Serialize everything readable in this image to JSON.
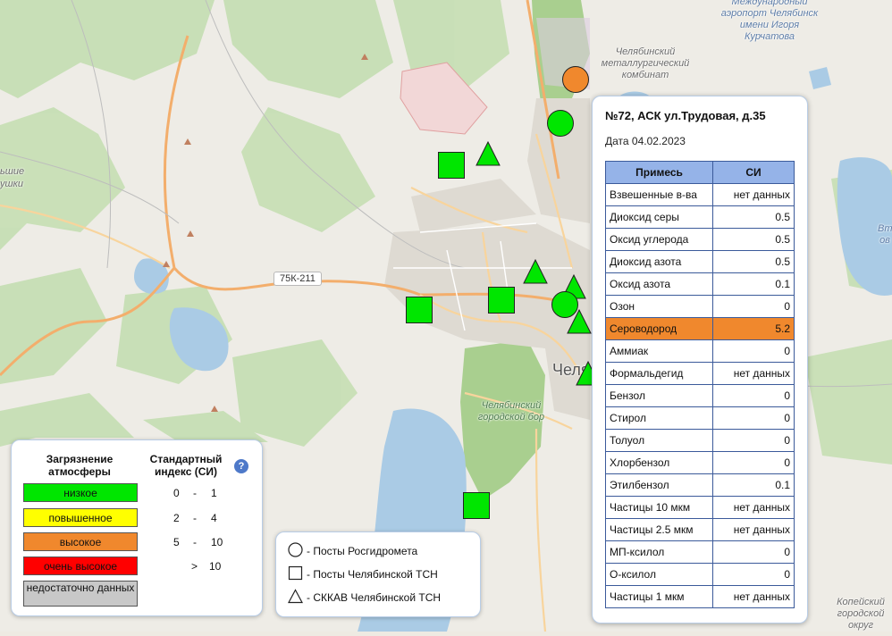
{
  "map": {
    "labels": {
      "airport": "Международный аэропорт Челябинск имени Игоря Курчатова",
      "metallurgical": "Челябинский металлургический комбинат",
      "forest": "Челябинский городской бор",
      "city": "Челя",
      "kopeysk": "Копейский городской округ",
      "edge_left_top": "ьшие",
      "edge_left_bottom": "ушки",
      "edge_right": "Вт ов"
    },
    "road_shield": "75К-211"
  },
  "markers": [
    {
      "shape": "circle",
      "color": "#f0882d",
      "level": "высокое"
    },
    {
      "shape": "circle",
      "color": "#00e600",
      "level": "низкое"
    },
    {
      "shape": "square",
      "color": "#00e600",
      "level": "низкое"
    },
    {
      "shape": "triangle",
      "color": "#00e600",
      "level": "низкое"
    },
    {
      "shape": "triangle",
      "color": "#00e600",
      "level": "низкое"
    },
    {
      "shape": "triangle",
      "color": "#00e600",
      "level": "низкое"
    },
    {
      "shape": "circle",
      "color": "#00e600",
      "level": "низкое"
    },
    {
      "shape": "triangle",
      "color": "#00e600",
      "level": "низкое"
    },
    {
      "shape": "square",
      "color": "#00e600",
      "level": "низкое"
    },
    {
      "shape": "square",
      "color": "#00e600",
      "level": "низкое"
    },
    {
      "shape": "triangle",
      "color": "#00e600",
      "level": "низкое"
    },
    {
      "shape": "square",
      "color": "#00e600",
      "level": "низкое"
    }
  ],
  "legend": {
    "header_pollution": "Загрязнение атмосферы",
    "header_index": "Стандартный индекс (СИ)",
    "help_icon": "?",
    "rows": [
      {
        "label": "низкое",
        "color": "#00e600",
        "from": "0",
        "dash": "-",
        "to": "1"
      },
      {
        "label": "повышенное",
        "color": "#ffff00",
        "from": "2",
        "dash": "-",
        "to": "4"
      },
      {
        "label": "высокое",
        "color": "#f0882d",
        "from": "5",
        "dash": "-",
        "to": "10"
      },
      {
        "label": "очень высокое",
        "color": "#ff0000",
        "from": "",
        "dash": ">",
        "to": "10"
      },
      {
        "label": "недостаточно данных",
        "color": "#c8c8c8",
        "from": "",
        "dash": "",
        "to": ""
      }
    ]
  },
  "symbols": {
    "circle_label": "- Посты Росгидромета",
    "square_label": "- Посты Челябинской ТСН",
    "triangle_label": "- СККАВ Челябинской ТСН"
  },
  "popup": {
    "title": "№72, АСК ул.Трудовая, д.35",
    "date": "Дата 04.02.2023",
    "col_substance": "Примесь",
    "col_index": "СИ",
    "highlight_color": "#f0882d",
    "rows": [
      {
        "name": "Взвешенные в-ва",
        "value": "нет данных"
      },
      {
        "name": "Диоксид серы",
        "value": "0.5"
      },
      {
        "name": "Оксид углерода",
        "value": "0.5"
      },
      {
        "name": "Диоксид азота",
        "value": "0.5"
      },
      {
        "name": "Оксид азота",
        "value": "0.1"
      },
      {
        "name": "Озон",
        "value": "0"
      },
      {
        "name": "Сероводород",
        "value": "5.2"
      },
      {
        "name": "Аммиак",
        "value": "0"
      },
      {
        "name": "Формальдегид",
        "value": "нет данных"
      },
      {
        "name": "Бензол",
        "value": "0"
      },
      {
        "name": "Стирол",
        "value": "0"
      },
      {
        "name": "Толуол",
        "value": "0"
      },
      {
        "name": "Хлорбензол",
        "value": "0"
      },
      {
        "name": "Этилбензол",
        "value": "0.1"
      },
      {
        "name": "Частицы 10 мкм",
        "value": "нет данных"
      },
      {
        "name": "Частицы 2.5 мкм",
        "value": "нет данных"
      },
      {
        "name": "МП-ксилол",
        "value": "0"
      },
      {
        "name": "О-ксилол",
        "value": "0"
      },
      {
        "name": "Частицы 1 мкм",
        "value": "нет данных"
      }
    ]
  }
}
